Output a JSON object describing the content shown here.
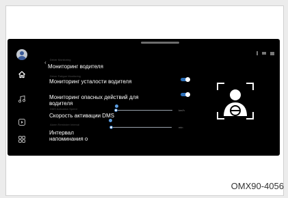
{
  "screen": {
    "crumb": "Driver Monitoring",
    "title": "Мониторинг водителя",
    "ghost_1": "Driver Fatigue Monitoring",
    "ghost_2": "DMS Activation Speed",
    "ghost_3": "Alarm Reminder Interval"
  },
  "settings": {
    "fatigue": {
      "label": "Мониторинг усталости водителя",
      "enabled": true
    },
    "dangerous": {
      "label": "Мониторинг опасных действий для водителя",
      "enabled": true
    },
    "speed": {
      "label": "Скорость активации DMS",
      "unit": "km/h",
      "level": 0.0
    },
    "interval": {
      "label": "Интервал напоминания о",
      "unit": "min",
      "level": 0.0
    }
  },
  "colors": {
    "accent": "#2c6fb8",
    "screen_bg": "#000000"
  },
  "icons": [
    "user-icon",
    "home-icon",
    "music-icon",
    "media-icon",
    "apps-icon"
  ],
  "figure_id": "OMX90-4056"
}
